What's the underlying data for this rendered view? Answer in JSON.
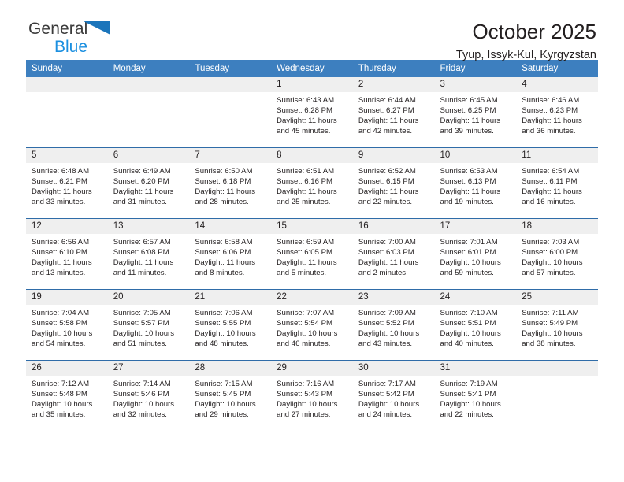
{
  "brand": {
    "line1": "General",
    "line2": "Blue",
    "accent_dark": "#3b3b3b",
    "accent_blue": "#1b8fe0",
    "triangle_color": "#1b75bb"
  },
  "header": {
    "title": "October 2025",
    "subtitle": "Tyup, Issyk-Kul, Kyrgyzstan"
  },
  "theme": {
    "header_row_bg": "#3d7fbf",
    "row_divider": "#2f6ca8",
    "daynum_bg": "#efefef",
    "text": "#231f20"
  },
  "weekdays": [
    "Sunday",
    "Monday",
    "Tuesday",
    "Wednesday",
    "Thursday",
    "Friday",
    "Saturday"
  ],
  "weeks": [
    [
      {
        "day": "",
        "sunrise": "",
        "sunset": "",
        "daylight_line1": "",
        "daylight_line2": ""
      },
      {
        "day": "",
        "sunrise": "",
        "sunset": "",
        "daylight_line1": "",
        "daylight_line2": ""
      },
      {
        "day": "",
        "sunrise": "",
        "sunset": "",
        "daylight_line1": "",
        "daylight_line2": ""
      },
      {
        "day": "1",
        "sunrise": "Sunrise: 6:43 AM",
        "sunset": "Sunset: 6:28 PM",
        "daylight_line1": "Daylight: 11 hours",
        "daylight_line2": "and 45 minutes."
      },
      {
        "day": "2",
        "sunrise": "Sunrise: 6:44 AM",
        "sunset": "Sunset: 6:27 PM",
        "daylight_line1": "Daylight: 11 hours",
        "daylight_line2": "and 42 minutes."
      },
      {
        "day": "3",
        "sunrise": "Sunrise: 6:45 AM",
        "sunset": "Sunset: 6:25 PM",
        "daylight_line1": "Daylight: 11 hours",
        "daylight_line2": "and 39 minutes."
      },
      {
        "day": "4",
        "sunrise": "Sunrise: 6:46 AM",
        "sunset": "Sunset: 6:23 PM",
        "daylight_line1": "Daylight: 11 hours",
        "daylight_line2": "and 36 minutes."
      }
    ],
    [
      {
        "day": "5",
        "sunrise": "Sunrise: 6:48 AM",
        "sunset": "Sunset: 6:21 PM",
        "daylight_line1": "Daylight: 11 hours",
        "daylight_line2": "and 33 minutes."
      },
      {
        "day": "6",
        "sunrise": "Sunrise: 6:49 AM",
        "sunset": "Sunset: 6:20 PM",
        "daylight_line1": "Daylight: 11 hours",
        "daylight_line2": "and 31 minutes."
      },
      {
        "day": "7",
        "sunrise": "Sunrise: 6:50 AM",
        "sunset": "Sunset: 6:18 PM",
        "daylight_line1": "Daylight: 11 hours",
        "daylight_line2": "and 28 minutes."
      },
      {
        "day": "8",
        "sunrise": "Sunrise: 6:51 AM",
        "sunset": "Sunset: 6:16 PM",
        "daylight_line1": "Daylight: 11 hours",
        "daylight_line2": "and 25 minutes."
      },
      {
        "day": "9",
        "sunrise": "Sunrise: 6:52 AM",
        "sunset": "Sunset: 6:15 PM",
        "daylight_line1": "Daylight: 11 hours",
        "daylight_line2": "and 22 minutes."
      },
      {
        "day": "10",
        "sunrise": "Sunrise: 6:53 AM",
        "sunset": "Sunset: 6:13 PM",
        "daylight_line1": "Daylight: 11 hours",
        "daylight_line2": "and 19 minutes."
      },
      {
        "day": "11",
        "sunrise": "Sunrise: 6:54 AM",
        "sunset": "Sunset: 6:11 PM",
        "daylight_line1": "Daylight: 11 hours",
        "daylight_line2": "and 16 minutes."
      }
    ],
    [
      {
        "day": "12",
        "sunrise": "Sunrise: 6:56 AM",
        "sunset": "Sunset: 6:10 PM",
        "daylight_line1": "Daylight: 11 hours",
        "daylight_line2": "and 13 minutes."
      },
      {
        "day": "13",
        "sunrise": "Sunrise: 6:57 AM",
        "sunset": "Sunset: 6:08 PM",
        "daylight_line1": "Daylight: 11 hours",
        "daylight_line2": "and 11 minutes."
      },
      {
        "day": "14",
        "sunrise": "Sunrise: 6:58 AM",
        "sunset": "Sunset: 6:06 PM",
        "daylight_line1": "Daylight: 11 hours",
        "daylight_line2": "and 8 minutes."
      },
      {
        "day": "15",
        "sunrise": "Sunrise: 6:59 AM",
        "sunset": "Sunset: 6:05 PM",
        "daylight_line1": "Daylight: 11 hours",
        "daylight_line2": "and 5 minutes."
      },
      {
        "day": "16",
        "sunrise": "Sunrise: 7:00 AM",
        "sunset": "Sunset: 6:03 PM",
        "daylight_line1": "Daylight: 11 hours",
        "daylight_line2": "and 2 minutes."
      },
      {
        "day": "17",
        "sunrise": "Sunrise: 7:01 AM",
        "sunset": "Sunset: 6:01 PM",
        "daylight_line1": "Daylight: 10 hours",
        "daylight_line2": "and 59 minutes."
      },
      {
        "day": "18",
        "sunrise": "Sunrise: 7:03 AM",
        "sunset": "Sunset: 6:00 PM",
        "daylight_line1": "Daylight: 10 hours",
        "daylight_line2": "and 57 minutes."
      }
    ],
    [
      {
        "day": "19",
        "sunrise": "Sunrise: 7:04 AM",
        "sunset": "Sunset: 5:58 PM",
        "daylight_line1": "Daylight: 10 hours",
        "daylight_line2": "and 54 minutes."
      },
      {
        "day": "20",
        "sunrise": "Sunrise: 7:05 AM",
        "sunset": "Sunset: 5:57 PM",
        "daylight_line1": "Daylight: 10 hours",
        "daylight_line2": "and 51 minutes."
      },
      {
        "day": "21",
        "sunrise": "Sunrise: 7:06 AM",
        "sunset": "Sunset: 5:55 PM",
        "daylight_line1": "Daylight: 10 hours",
        "daylight_line2": "and 48 minutes."
      },
      {
        "day": "22",
        "sunrise": "Sunrise: 7:07 AM",
        "sunset": "Sunset: 5:54 PM",
        "daylight_line1": "Daylight: 10 hours",
        "daylight_line2": "and 46 minutes."
      },
      {
        "day": "23",
        "sunrise": "Sunrise: 7:09 AM",
        "sunset": "Sunset: 5:52 PM",
        "daylight_line1": "Daylight: 10 hours",
        "daylight_line2": "and 43 minutes."
      },
      {
        "day": "24",
        "sunrise": "Sunrise: 7:10 AM",
        "sunset": "Sunset: 5:51 PM",
        "daylight_line1": "Daylight: 10 hours",
        "daylight_line2": "and 40 minutes."
      },
      {
        "day": "25",
        "sunrise": "Sunrise: 7:11 AM",
        "sunset": "Sunset: 5:49 PM",
        "daylight_line1": "Daylight: 10 hours",
        "daylight_line2": "and 38 minutes."
      }
    ],
    [
      {
        "day": "26",
        "sunrise": "Sunrise: 7:12 AM",
        "sunset": "Sunset: 5:48 PM",
        "daylight_line1": "Daylight: 10 hours",
        "daylight_line2": "and 35 minutes."
      },
      {
        "day": "27",
        "sunrise": "Sunrise: 7:14 AM",
        "sunset": "Sunset: 5:46 PM",
        "daylight_line1": "Daylight: 10 hours",
        "daylight_line2": "and 32 minutes."
      },
      {
        "day": "28",
        "sunrise": "Sunrise: 7:15 AM",
        "sunset": "Sunset: 5:45 PM",
        "daylight_line1": "Daylight: 10 hours",
        "daylight_line2": "and 29 minutes."
      },
      {
        "day": "29",
        "sunrise": "Sunrise: 7:16 AM",
        "sunset": "Sunset: 5:43 PM",
        "daylight_line1": "Daylight: 10 hours",
        "daylight_line2": "and 27 minutes."
      },
      {
        "day": "30",
        "sunrise": "Sunrise: 7:17 AM",
        "sunset": "Sunset: 5:42 PM",
        "daylight_line1": "Daylight: 10 hours",
        "daylight_line2": "and 24 minutes."
      },
      {
        "day": "31",
        "sunrise": "Sunrise: 7:19 AM",
        "sunset": "Sunset: 5:41 PM",
        "daylight_line1": "Daylight: 10 hours",
        "daylight_line2": "and 22 minutes."
      },
      {
        "day": "",
        "sunrise": "",
        "sunset": "",
        "daylight_line1": "",
        "daylight_line2": ""
      }
    ]
  ]
}
